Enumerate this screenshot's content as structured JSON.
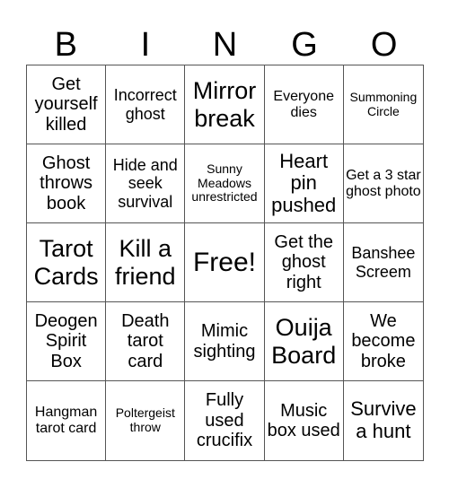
{
  "header": {
    "letters": [
      "B",
      "I",
      "N",
      "G",
      "O"
    ]
  },
  "cells": [
    "Get yourself killed",
    "Incorrect ghost",
    "Mirror break",
    "Everyone dies",
    "Summoning Circle",
    "Ghost throws book",
    "Hide and seek survival",
    "Sunny Meadows unrestricted",
    "Heart pin pushed",
    "Get a 3 star ghost photo",
    "Tarot Cards",
    "Kill a friend",
    "Free!",
    "Get the ghost right",
    "Banshee Screem",
    "Deogen Spirit Box",
    "Death tarot card",
    "Mimic sighting",
    "Ouija Board",
    "We become broke",
    "Hangman tarot card",
    "Poltergeist throw",
    "Fully used crucifix",
    "Music box used",
    "Survive a hunt"
  ]
}
